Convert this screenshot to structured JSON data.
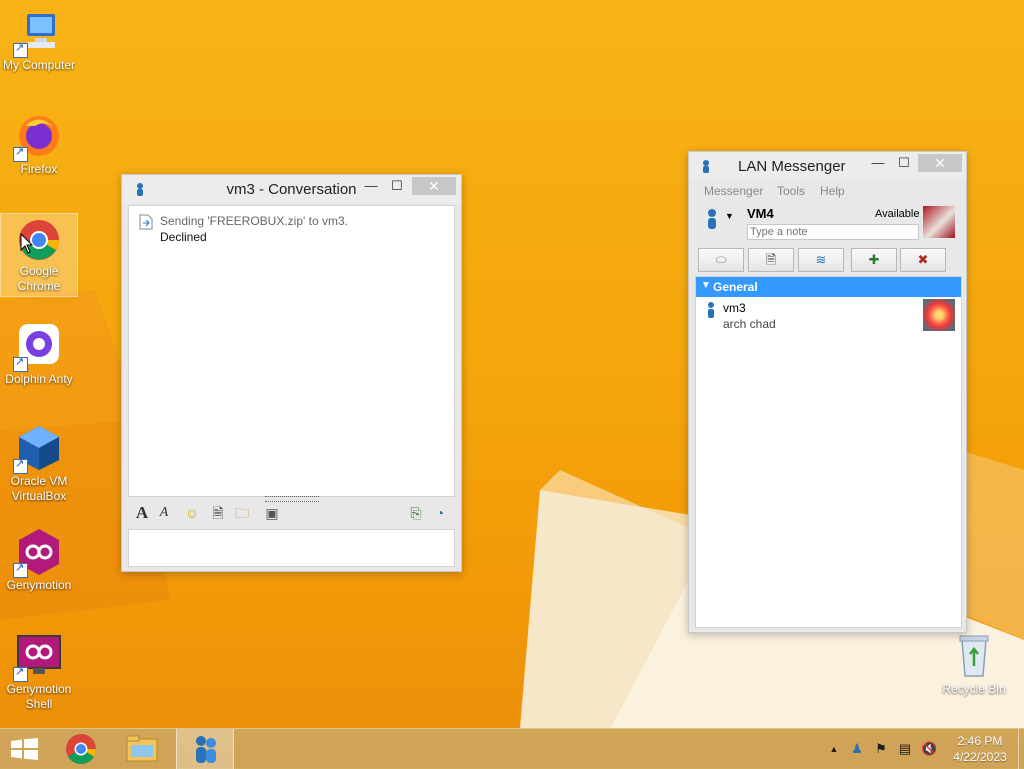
{
  "desktop": {
    "icons": [
      {
        "label": "My Computer",
        "icon": "computer-icon"
      },
      {
        "label": "Firefox",
        "icon": "firefox-icon"
      },
      {
        "label": "Google Chrome",
        "icon": "chrome-icon"
      },
      {
        "label": "Dolphin Anty",
        "icon": "dolphin-anty-icon"
      },
      {
        "label": "Oracle VM VirtualBox",
        "icon": "virtualbox-icon"
      },
      {
        "label": "Genymotion",
        "icon": "genymotion-icon"
      },
      {
        "label": "Genymotion Shell",
        "icon": "genymotion-shell-icon"
      },
      {
        "label": "Recycle Bin",
        "icon": "recycle-bin-icon"
      }
    ]
  },
  "conversation": {
    "title": "vm3 - Conversation",
    "messages": [
      {
        "text": "Sending 'FREEROBUX.zip' to vm3.",
        "status": "Declined"
      }
    ],
    "input_value": "",
    "colors": {
      "text_muted": "#666666"
    }
  },
  "messenger": {
    "title": "LAN Messenger",
    "menu": [
      "Messenger",
      "Tools",
      "Help"
    ],
    "user": {
      "name": "VM4",
      "status": "Available",
      "note_placeholder": "Type a note"
    },
    "group": {
      "name": "General"
    },
    "contacts": [
      {
        "name": "vm3",
        "note": "arch chad"
      }
    ],
    "colors": {
      "group_header": "#3399ff"
    }
  },
  "taskbar": {
    "clock_time": "2:46 PM",
    "clock_date": "4/22/2023"
  }
}
